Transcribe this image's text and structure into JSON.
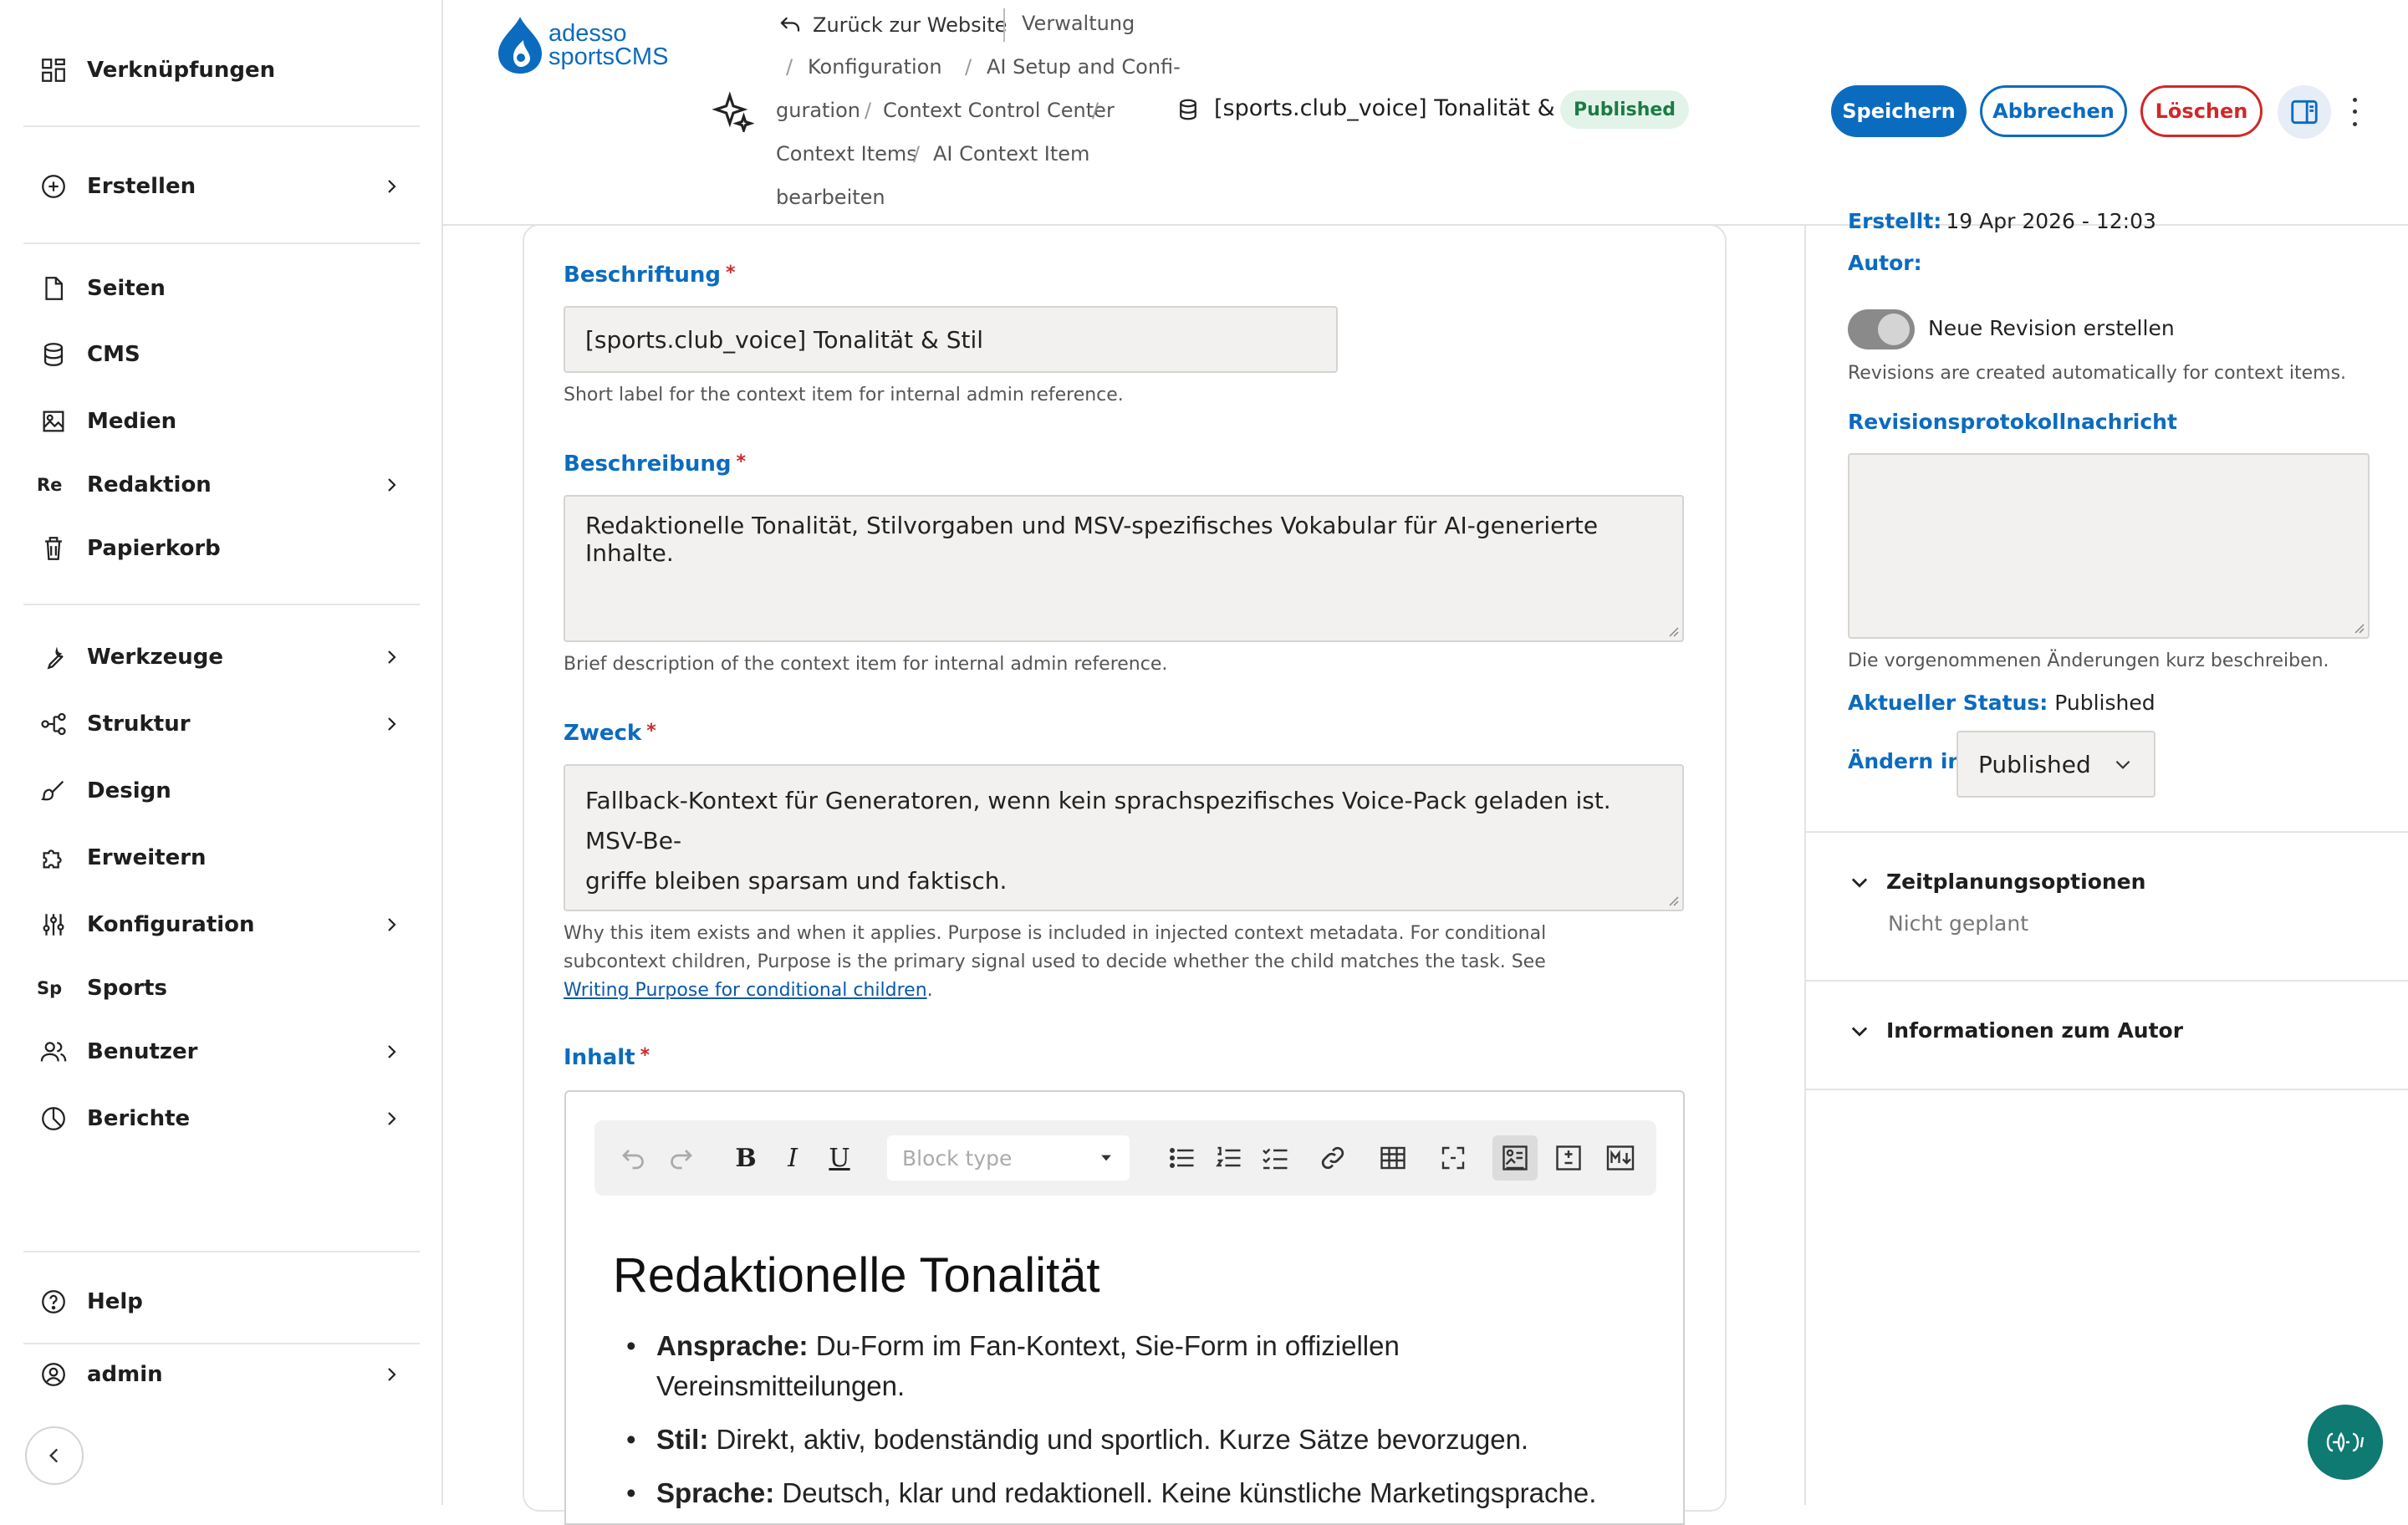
{
  "sidebar": {
    "shortcuts": "Verknüpfungen",
    "create": "Erstellen",
    "pages": "Seiten",
    "cms": "CMS",
    "media": "Medien",
    "editorial": "Redaktion",
    "editorial_abbr": "Re",
    "trash": "Papierkorb",
    "tools": "Werkzeuge",
    "structure": "Struktur",
    "design": "Design",
    "extend": "Erweitern",
    "config": "Konfiguration",
    "sports": "Sports",
    "sports_abbr": "Sp",
    "users": "Benutzer",
    "reports": "Berichte",
    "help": "Help",
    "admin": "admin"
  },
  "brand": {
    "line1": "adesso",
    "line2": "sportsCMS"
  },
  "breadcrumb": {
    "back": "Zurück zur Website",
    "items": [
      "Verwaltung",
      "Konfiguration",
      "AI Setup and Confi-",
      "guration",
      "Context Control Center",
      "Context Items",
      "AI Context Item",
      "bearbeiten"
    ]
  },
  "header": {
    "title": "[sports.club_voice] Tonalität & Stil",
    "status_badge": "Published",
    "save": "Speichern",
    "cancel": "Abbrechen",
    "delete": "Löschen"
  },
  "form": {
    "label_field": {
      "label": "Beschriftung",
      "value": "[sports.club_voice] Tonalität & Stil",
      "help": "Short label for the context item for internal admin reference."
    },
    "description_field": {
      "label": "Beschreibung",
      "value": "Redaktionelle Tonalität, Stilvorgaben und MSV-spezifisches Vokabular für AI-generierte Inhalte.",
      "help": "Brief description of the context item for internal admin reference."
    },
    "purpose_field": {
      "label": "Zweck",
      "value_line1": "Fallback-Kontext für Generatoren, wenn kein sprachspezifisches Voice-Pack geladen ist. MSV-Be-",
      "value_line2": "griffe bleiben sparsam und faktisch.",
      "help_line1": "Why this item exists and when it applies. Purpose is included in injected context metadata. For conditional",
      "help_line2": "subcontext children, Purpose is the primary signal used to decide whether the child matches the task. See",
      "help_link": "Writing Purpose for conditional children",
      "help_end": "."
    },
    "content_field": {
      "label": "Inhalt",
      "block_type_placeholder": "Block type",
      "heading": "Redaktionelle Tonalität",
      "bullets": [
        {
          "term": "Ansprache:",
          "text_line1": " Du-Form im Fan-Kontext, Sie-Form in offiziellen",
          "text_line2": "Vereinsmitteilungen."
        },
        {
          "term": "Stil:",
          "text_line1": " Direkt, aktiv, bodenständig und sportlich. Kurze Sätze bevorzugen.",
          "text_line2": ""
        },
        {
          "term": "Sprache:",
          "text_line1": " Deutsch, klar und redaktionell. Keine künstliche Marketingsprache.",
          "text_line2": ""
        }
      ]
    }
  },
  "sidebar_right": {
    "created_label": "Erstellt:",
    "created_value": "19 Apr 2026 - 12:03",
    "author_label": "Autor:",
    "new_revision_label": "Neue Revision erstellen",
    "revision_note": "Revisions are created automatically for context items.",
    "revision_log_label": "Revisionsprotokollnachricht",
    "revision_log_help": "Die vorgenommenen Änderungen kurz beschreiben.",
    "current_status_label": "Aktueller Status:",
    "current_status_value": "Published",
    "change_to_label": "Ändern in:",
    "change_to_value": "Published",
    "scheduling_title": "Zeitplanungsoptionen",
    "scheduling_value": "Nicht geplant",
    "author_info_title": "Informationen zum Autor"
  },
  "colors": {
    "primary": "#0b6bbf",
    "danger": "#d02828",
    "success_bg": "#e2f4ea",
    "success_text": "#1e7a45",
    "chat": "#0e7a72"
  }
}
